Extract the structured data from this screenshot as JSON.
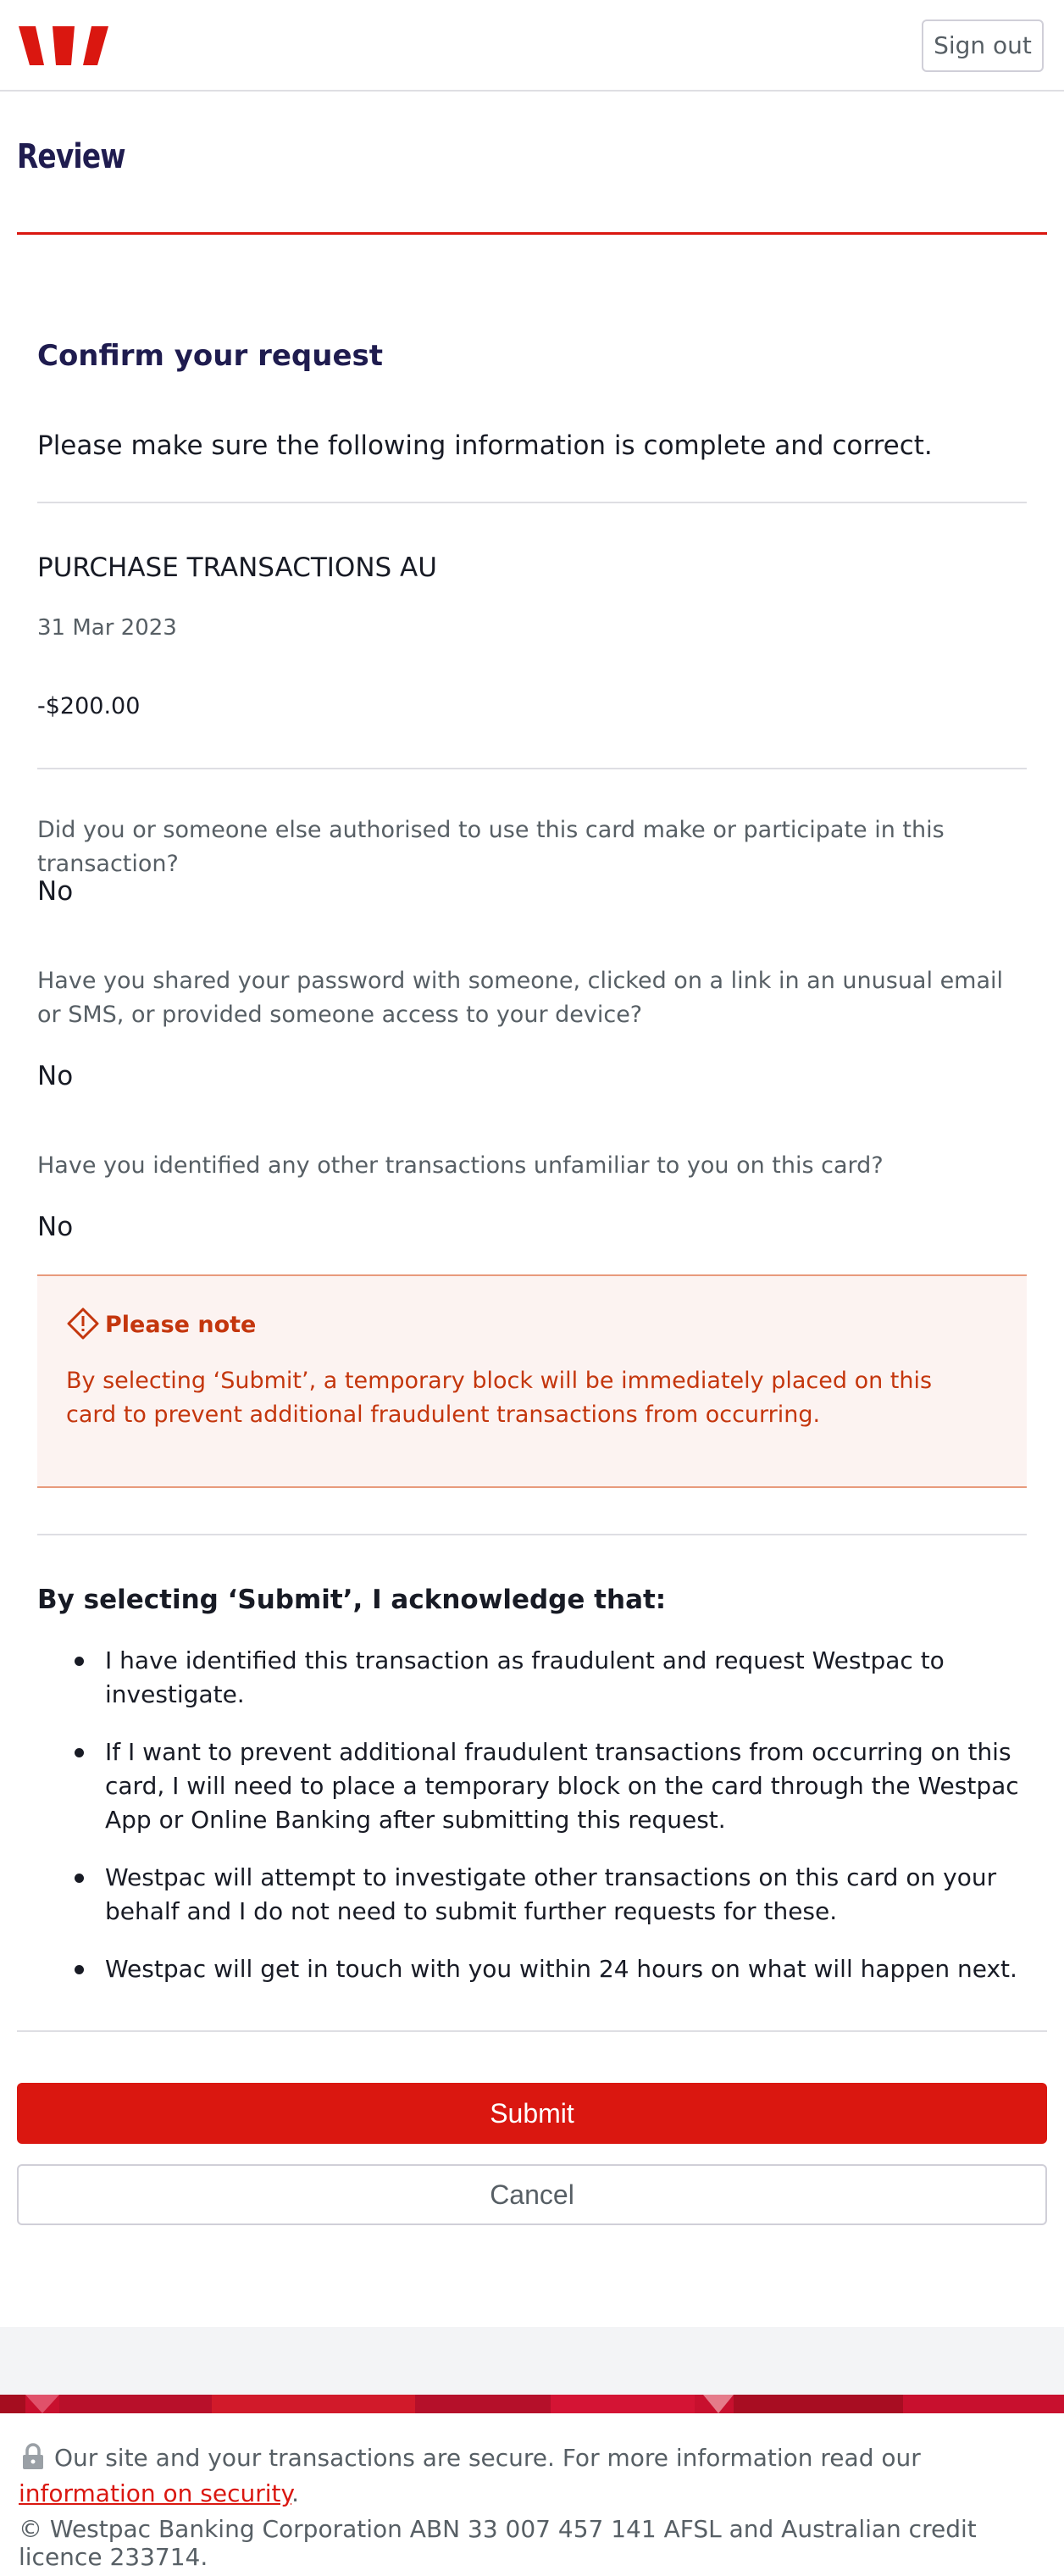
{
  "header": {
    "logo_icon": "westpac-w-logo-icon",
    "sign_out_label": "Sign out"
  },
  "page": {
    "title": "Review"
  },
  "confirm": {
    "heading": "Confirm your request",
    "intro": "Please make sure the following information is complete and correct."
  },
  "transaction": {
    "name": "PURCHASE TRANSACTIONS AU",
    "date": "31 Mar 2023",
    "amount": "-$200.00"
  },
  "questions": [
    {
      "question": "Did you or someone else authorised to use this card make or participate in this transaction?",
      "answer": "No"
    },
    {
      "question": "Have you shared your password with someone, clicked on a link in an unusual email or SMS, or provided someone access to your device?",
      "answer": "No"
    },
    {
      "question": "Have you identified any other transactions unfamiliar to you on this card?",
      "answer": "No"
    }
  ],
  "note": {
    "icon": "warning-diamond-icon",
    "title": "Please note",
    "body": "By selecting ‘Submit’, a temporary block will be immediately placed on this card to prevent additional fraudulent transactions from occurring."
  },
  "acknowledgement": {
    "heading": "By selecting ‘Submit’, I acknowledge that:",
    "items": [
      "I have identified this transaction as fraudulent and request Westpac to investigate.",
      "If I want to prevent additional fraudulent transactions from occurring on this card, I will need to place a temporary block on the card through the Westpac App or Online Banking after submitting this request.",
      "Westpac will attempt to investigate other transactions on this card on your behalf and I do not need to submit further requests for these.",
      "Westpac will get in touch with you within 24 hours on what will happen next."
    ]
  },
  "actions": {
    "submit_label": "Submit",
    "cancel_label": "Cancel"
  },
  "footer": {
    "lock_icon": "lock-icon",
    "security_text": "Our site and your transactions are secure. For more information read our",
    "security_link": "information on security",
    "security_end": ".",
    "copyright": "© Westpac Banking Corporation ABN 33 007 457 141 AFSL and Australian credit licence 233714."
  },
  "colors": {
    "brand_red": "#da1710",
    "heading_navy": "#1f1c4f",
    "note_orange": "#c4360d",
    "note_bg": "#fcf3f1"
  }
}
